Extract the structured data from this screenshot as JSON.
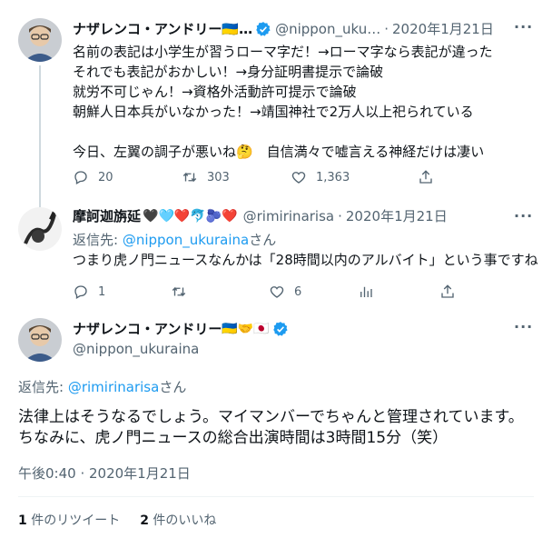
{
  "tweet1": {
    "name": "ナザレンコ・アンドリー",
    "flag_emoji": "🇺🇦",
    "ellipsis": "…",
    "handle": "@nippon_uku…",
    "dot": "·",
    "date": "2020年1月21日",
    "text": "名前の表記は小学生が習うローマ字だ！→ローマ字なら表記が違った\nそれでも表記がおかしい！→身分証明書提示で論破\n就労不可じゃん！→資格外活動許可提示で論破\n朝鮮人日本兵がいなかった！→靖国神社で2万人以上祀られている\n\n今日、左翼の調子が悪いね🤔　自信満々で嘘言える神経だけは凄い",
    "replies": "20",
    "retweets": "303",
    "likes": "1,363",
    "more": "···"
  },
  "tweet2": {
    "name": "摩訶迦旃延",
    "name_emojis": "🖤🩵❤️🐬🫐❤️",
    "handle": "@rimirinarisa",
    "dot": "·",
    "date": "2020年1月21日",
    "reply_prefix": "返信先: ",
    "reply_handle": "@nippon_ukuraina",
    "reply_suffix": "さん",
    "text": "つまり虎ノ門ニュースなんかは「28時間以内のアルバイト」という事ですね",
    "replies": "1",
    "retweets": "",
    "likes": "6",
    "more": "···"
  },
  "main": {
    "name": "ナザレンコ・アンドリー",
    "name_emojis": "🇺🇦🤝🇯🇵",
    "handle": "@nippon_ukuraina",
    "reply_prefix": "返信先: ",
    "reply_handle": "@rimirinarisa",
    "reply_suffix": "さん",
    "text": "法律上はそうなるでしょう。マイマンバーでちゃんと管理されています。\nちなみに、虎ノ門ニュースの総合出演時間は3時間15分（笑）",
    "time": "午後0:40 · 2020年1月21日",
    "retweet_count": "1",
    "retweet_label": " 件のリツイート",
    "like_count": "2",
    "like_label": " 件のいいね",
    "more": "···"
  },
  "colors": {
    "link": "#1d9bf0",
    "secondary": "#536471",
    "verified": "#1d9bf0",
    "divider": "#eff3f4"
  }
}
